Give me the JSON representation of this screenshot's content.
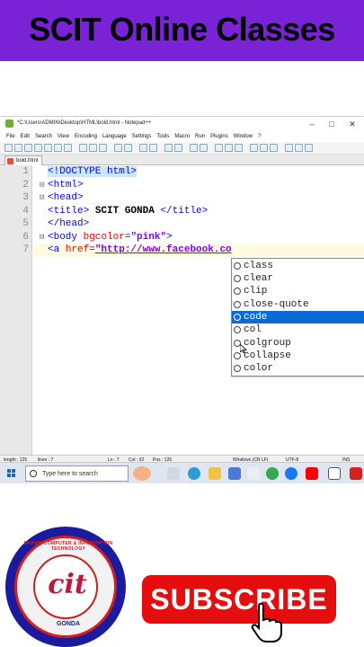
{
  "banner": {
    "title": "SCIT Online Classes"
  },
  "window": {
    "title": "*C:\\Users\\ADMIN\\Desktop\\HTML\\bold.html - Notepad++",
    "menu": [
      "File",
      "Edit",
      "Search",
      "View",
      "Encoding",
      "Language",
      "Settings",
      "Tools",
      "Macro",
      "Run",
      "Plugins",
      "Window",
      "?"
    ],
    "tab": "bold.html"
  },
  "editor": {
    "line_numbers": [
      "1",
      "2",
      "3",
      "4",
      "5",
      "6",
      "7"
    ],
    "lines": [
      {
        "a": "<!DOCTYPE html>"
      },
      {
        "a": "<html>"
      },
      {
        "a": "<head>"
      },
      {
        "a": "<title>",
        "b": " SCIT GONDA ",
        "c": "</title>"
      },
      {
        "a": "</head>"
      },
      {
        "a": "<body ",
        "b": "bgcolor",
        "c": "=",
        "d": "\"pink\"",
        "e": ">"
      },
      {
        "a": "<a ",
        "b": "href",
        "c": "=",
        "d": "\"http://www.facebook.co"
      }
    ]
  },
  "autocomplete": {
    "items": [
      "class",
      "clear",
      "clip",
      "close-quote",
      "code",
      "col",
      "colgroup",
      "collapse",
      "color"
    ],
    "selected": "code"
  },
  "statusbar": {
    "length": "length : 125",
    "lines": "lines : 7",
    "ln": "Ln : 7",
    "col": "Col : 32",
    "pos": "Pos : 126",
    "eol": "Windows (CR LF)",
    "encoding": "UTF-8",
    "mode": "INS"
  },
  "taskbar": {
    "search_placeholder": "Type here to search"
  },
  "promo": {
    "logo_text": "cit",
    "logo_arc": "SHASHI COMPUTER & INFORMATION TECHNOLOGY",
    "logo_bottom": "GONDA",
    "subscribe": "SUBSCRIBE"
  },
  "colors": {
    "banner": "#7a22d6",
    "subscribe": "#e40e0e",
    "selection": "#0b6bd6"
  }
}
